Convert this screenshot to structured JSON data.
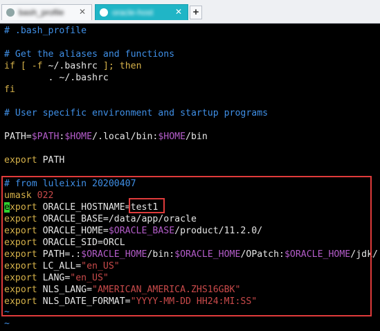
{
  "tabs": [
    {
      "label": "bash_profile",
      "close": "✕"
    },
    {
      "label": "oracle-host",
      "close": "✕"
    }
  ],
  "new_tab": "+",
  "terminal": {
    "l1": {
      "a": "# .bash_profile"
    },
    "l2": {
      "a": "# Get the aliases and functions"
    },
    "l3": {
      "a": "if [ -f ",
      "b": "~/.bashrc",
      "c": " ]; then"
    },
    "l4": {
      "a": "        . ~/.bashrc"
    },
    "l5": {
      "a": "fi"
    },
    "l6": {
      "a": "# User specific environment and startup programs"
    },
    "l7": {
      "a": "PATH=",
      "b": "$PATH",
      "c": ":",
      "d": "$HOME",
      "e": "/.local/bin:",
      "f": "$HOME",
      "g": "/bin"
    },
    "l8": {
      "a": "export",
      "b": " PATH"
    },
    "l9": {
      "a": "# from luleixin 20200407"
    },
    "l10": {
      "a": "umask ",
      "b": "022"
    },
    "l11": {
      "cur": "e",
      "a": "xport",
      "b": " ORACLE_HOSTNAME=",
      "c": "test1"
    },
    "l12": {
      "a": "export",
      "b": " ORACLE_BASE=/data/app/oracle"
    },
    "l13": {
      "a": "export",
      "b": " ORACLE_HOME=",
      "c": "$ORACLE_BASE",
      "d": "/product/11.2.0/"
    },
    "l14": {
      "a": "export",
      "b": " ORACLE_SID=ORCL"
    },
    "l15": {
      "a": "export",
      "b": " PATH=.:",
      "c": "$ORACLE_HOME",
      "d": "/bin:",
      "e": "$ORACLE_HOME",
      "f": "/OPatch:",
      "g": "$ORACLE_HOME",
      "h": "/jdk/"
    },
    "l16": {
      "a": "export",
      "b": " LC_ALL=",
      "c": "\"en_US\""
    },
    "l17": {
      "a": "export",
      "b": " LANG=",
      "c": "\"en_US\""
    },
    "l18": {
      "a": "export",
      "b": " NLS_LANG=",
      "c": "\"AMERICAN_AMERICA.ZHS16GBK\""
    },
    "l19": {
      "a": "export",
      "b": " NLS_DATE_FORMAT=",
      "c": "\"YYYY-MM-DD HH24:MI:SS\""
    },
    "l20": {
      "a": "~"
    },
    "l21": {
      "a": "~"
    }
  },
  "colors": {
    "comment": "#3f8fe6",
    "keyword": "#d6b24a",
    "variable": "#b35cc9",
    "string": "#c94a4a",
    "cursor": "#2fd12f",
    "highlight_box": "#e03b3b",
    "active_tab": "#20b5c6"
  }
}
